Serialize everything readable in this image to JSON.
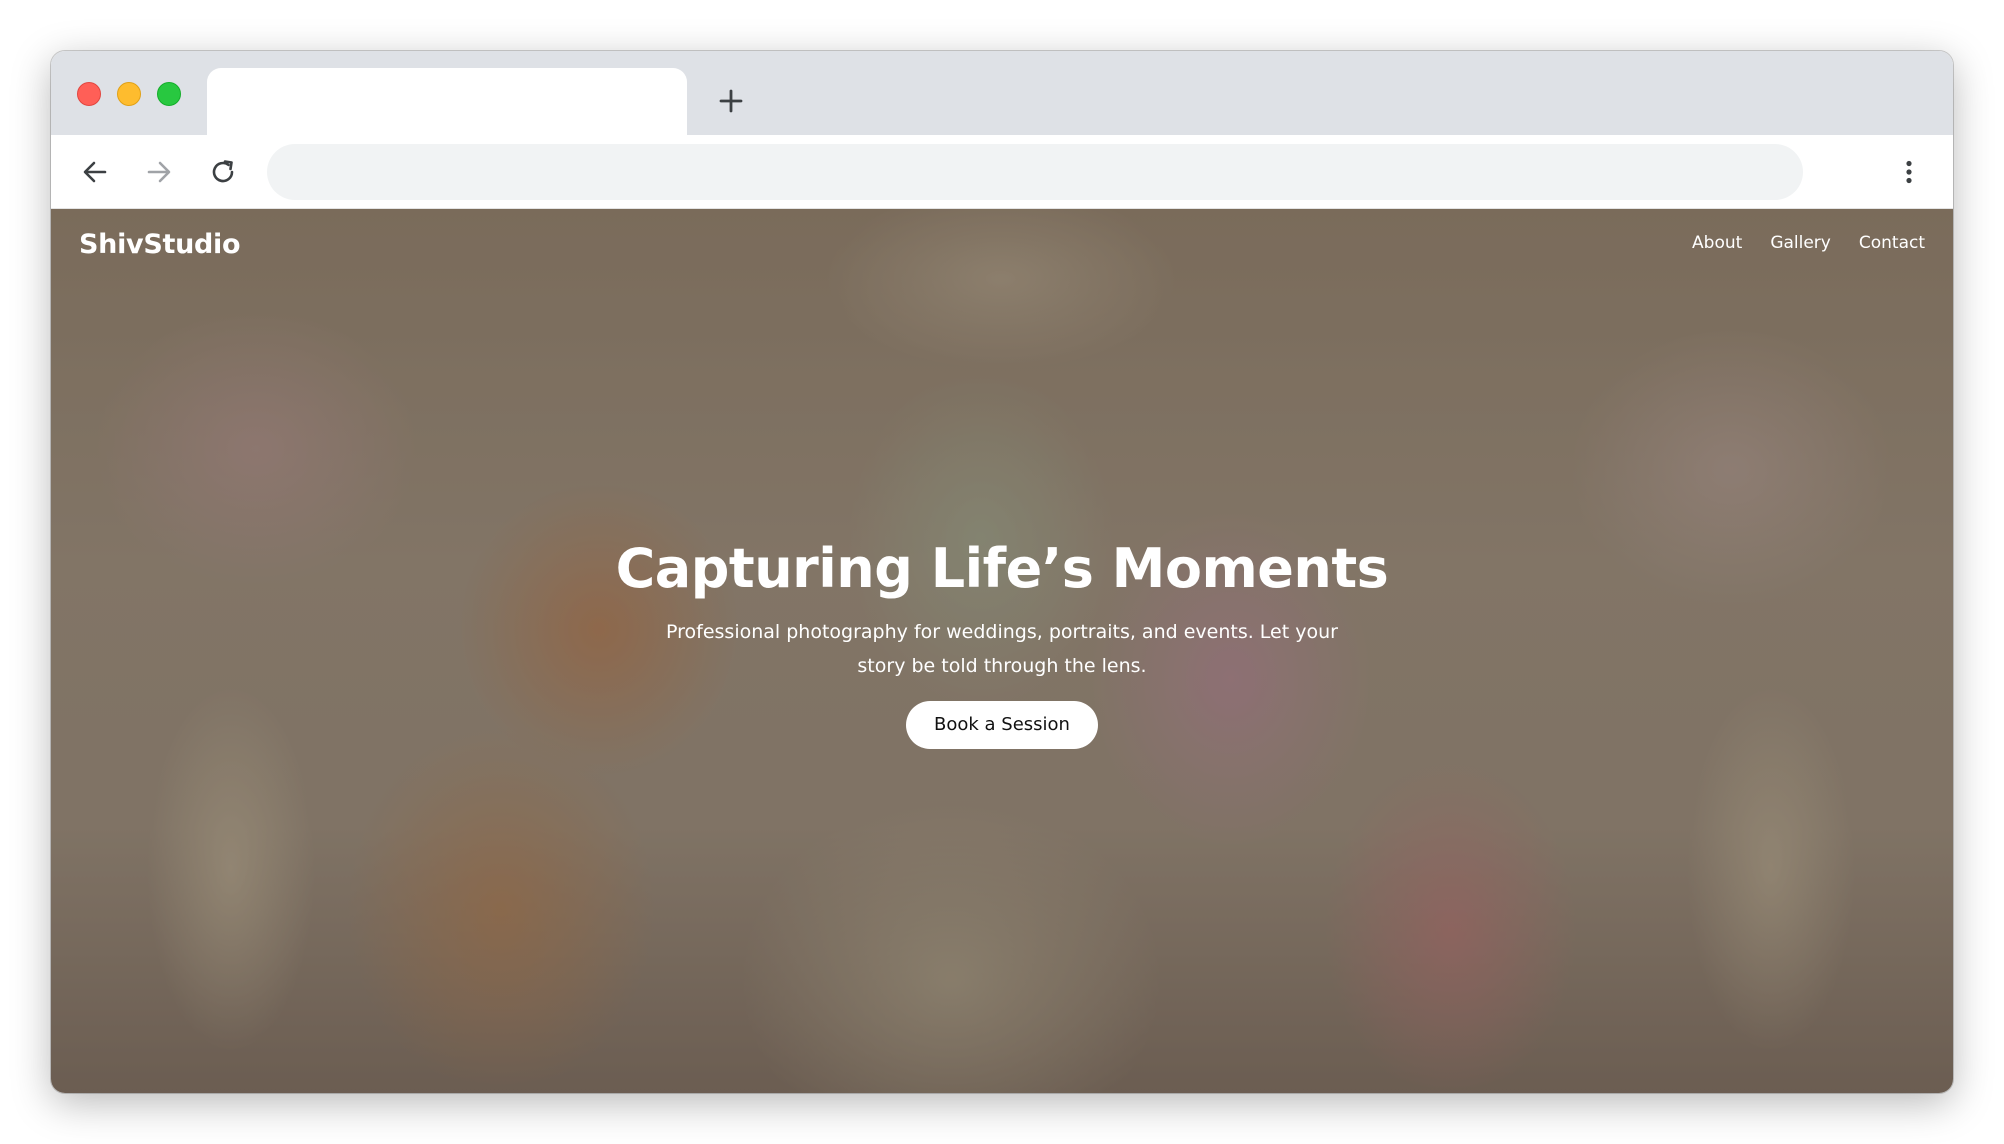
{
  "browser": {
    "tab_title": "",
    "address_value": "",
    "new_tab_icon": "plus-icon",
    "icons": {
      "back": "arrow-left-icon",
      "forward": "arrow-right-icon",
      "reload": "reload-icon",
      "menu": "kebab-menu-icon"
    },
    "colors": {
      "close": "#ff5f57",
      "minimize": "#febc2e",
      "maximize": "#28c840",
      "tabstrip": "#dee1e6",
      "omnibox": "#f1f3f4"
    }
  },
  "site": {
    "brand": "ShivStudio",
    "nav": [
      {
        "label": "About"
      },
      {
        "label": "Gallery"
      },
      {
        "label": "Contact"
      }
    ],
    "hero": {
      "title": "Capturing Life’s Moments",
      "subtitle": "Professional photography for weddings, portraits, and events. Let your story be told through the lens.",
      "cta_label": "Book a Session"
    }
  }
}
